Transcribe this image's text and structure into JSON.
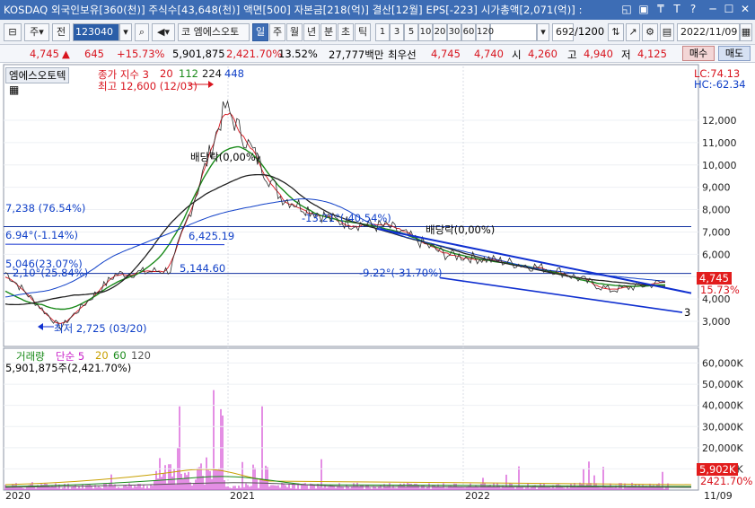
{
  "titlebar": {
    "text": "KOSDAQ 외국인보유[360(천)] 주식수[43,648(천)] 액면[500] 자본금[218(억)] 결산[12월] EPS[-223] 시가총액[2,071(억)] :",
    "icons": [
      "restore-icon",
      "stack-icon",
      "pin-icon",
      "font-icon",
      "help-icon",
      "minimize-icon",
      "maximize-icon",
      "close-icon"
    ],
    "color": "#3d6db5"
  },
  "toolbar": {
    "market": "주",
    "period_label": "전",
    "code": "123040",
    "stock_name": "엠에스오토",
    "prefix": "코",
    "periods": [
      "일",
      "주",
      "월",
      "년",
      "분",
      "초",
      "틱"
    ],
    "selected_period": "일",
    "intervals": [
      "1",
      "3",
      "5",
      "10",
      "20",
      "30",
      "60",
      "120"
    ],
    "count": "692",
    "count_total": "/1200",
    "date": "2022/11/09"
  },
  "pricebar": {
    "price": "4,745",
    "change": "645",
    "change_pct": "+15.73%",
    "volume": "5,901,875",
    "volume_pct": "2,421.70%",
    "turnover": "13.52%",
    "amount": "27,777백만",
    "prior_label": "최우선",
    "ask": "4,745",
    "bid": "4,740",
    "open_label": "시",
    "open": "4,260",
    "high_label": "고",
    "high": "4,940",
    "low_label": "저",
    "low": "4,125",
    "buy_label": "매수",
    "sell_label": "매도"
  },
  "chart": {
    "stock_name": "엠에스오토텍",
    "legend_prefix": "종가 지수 3",
    "ma_periods": [
      "20",
      "112",
      "224",
      "448"
    ],
    "ma_colors": [
      "#d8141e",
      "#1a8a1a",
      "#222222",
      "#1040c8"
    ],
    "high_note": "최고 12,600 (12/03)",
    "low_note": "최저 2,725 (03/20)",
    "dividend_notes": [
      "배당락(0,00%)",
      "배당락(0,00%)"
    ],
    "lc": "LC:74.13",
    "hc": "HC:-62.34",
    "hlines": [
      "7,238 (76.54%)",
      "5,144.60"
    ],
    "labels": {
      "l1": "6.94°(-1.14%)",
      "l2": "5,046(23.07%)",
      "l3": "2,10°(25.84%)",
      "l4": "6,425.19",
      "l5": "-13.21°(-40.54%)",
      "l6": "-9.22°(-31.70%)",
      "channel": "3"
    },
    "current_price": "4,745",
    "current_pct": "15.73%",
    "y_ticks": [
      "12,000",
      "11,000",
      "10,000",
      "9,000",
      "8,000",
      "7,000",
      "6,000",
      "5,000",
      "4,000",
      "3,000"
    ],
    "x_labels": [
      "2020",
      "2021",
      "2022",
      "11/09"
    ]
  },
  "volume": {
    "legend_title": "거래량",
    "legend_ma": "단순 5",
    "ma_periods": [
      "20",
      "60",
      "120"
    ],
    "ma_colors": [
      "#d8141e",
      "#c8a000",
      "#1a8a1a",
      "#555555"
    ],
    "volume_note": "5,901,875주(2,421.70%)",
    "y_ticks": [
      "60,000K",
      "50,000K",
      "40,000K",
      "30,000K",
      "20,000K",
      "10,000K"
    ],
    "current": "5,902K",
    "current_pct": "2421.70%"
  },
  "chart_data": {
    "type": "line",
    "title": "엠에스오토텍",
    "ylabel": "",
    "ylim": [
      2500,
      12800
    ],
    "x": [
      "2020-01",
      "2020-03",
      "2020-06",
      "2020-09",
      "2020-12",
      "2021-03",
      "2021-06",
      "2021-09",
      "2021-12",
      "2022-03",
      "2022-06",
      "2022-09",
      "2022-11"
    ],
    "series": [
      {
        "name": "종가",
        "values": [
          5200,
          2725,
          5100,
          5300,
          12600,
          8600,
          7500,
          7200,
          6000,
          5700,
          5300,
          4400,
          4745
        ]
      }
    ],
    "volume_series": {
      "name": "거래량",
      "unit": "K",
      "latest": 5902,
      "ylim": [
        0,
        67000
      ]
    }
  }
}
